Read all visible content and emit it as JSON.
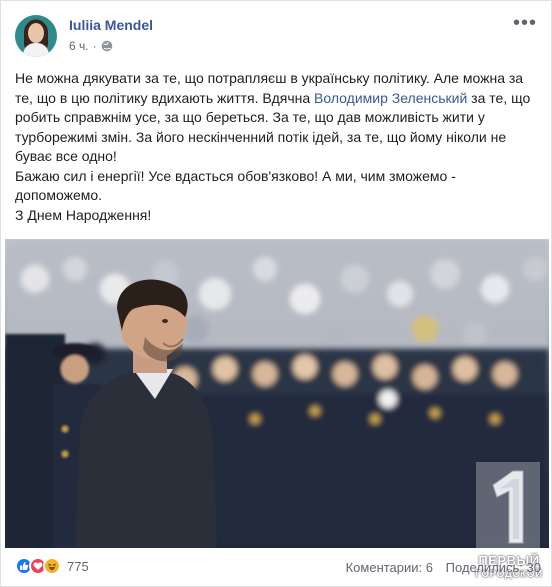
{
  "post": {
    "author": "Iuliia Mendel",
    "time": "6 ч.",
    "more_label": "•••",
    "text": {
      "line1_before_mention": "Не можна дякувати за те, що потрапляєш в українську політику. Але можна за те, що в цю політику вдихають життя. Вдячна ",
      "mention": "Володимир Зеленський",
      "line1_after_mention": " за те, що робить справжнім усе, за що береться. За те, що дав можливість жити у турборежимі змін. За його нескінченний потік ідей, за те, що йому ніколи не буває все одно!",
      "paragraph2": "Бажаю сил і енергії! Усе вдасться обов'язково! А ми, чим зможемо - допоможемо.",
      "paragraph3": "З Днем Народження!"
    }
  },
  "footer": {
    "reaction_count": "775",
    "comments": "Коментарии: 6",
    "shares": "Поделились: 30"
  },
  "watermark": {
    "line1": "ПЕРВЫЙ",
    "line2": "ГОРОДСКОЙ"
  },
  "icons": {
    "globe": "globe-icon",
    "more": "more-icon",
    "like": "like-reaction-icon",
    "love": "love-reaction-icon",
    "haha": "haha-reaction-icon"
  },
  "colors": {
    "link": "#385898",
    "like": "#1877f2",
    "love": "#f33e58",
    "haha": "#f7b125"
  }
}
